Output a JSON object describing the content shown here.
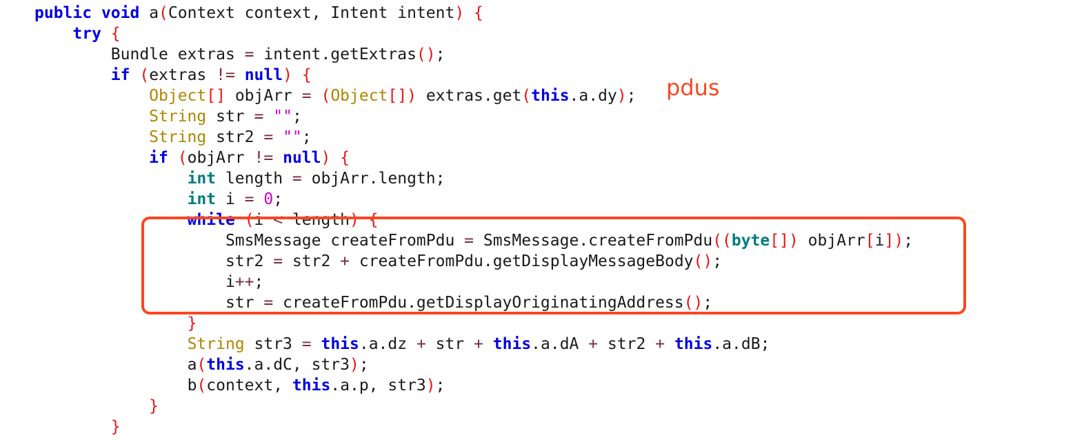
{
  "colors": {
    "keyword": "#0000e6",
    "type": "#ae8600",
    "primitive": "#007c80",
    "punctuation": "#ee1111",
    "string": "#cc00cc",
    "number": "#cc00cc",
    "operator": "#7a2a3a",
    "identifier": "#1a1a1a",
    "annotation": "#fa4620"
  },
  "annotation": {
    "text": "pdus"
  },
  "code": [
    {
      "indent": 0,
      "tokens": [
        [
          "kw",
          "public"
        ],
        [
          "id",
          " "
        ],
        [
          "kw",
          "void"
        ],
        [
          "id",
          " a"
        ],
        [
          "pn",
          "("
        ],
        [
          "id",
          "Context context, Intent intent"
        ],
        [
          "pn",
          ")"
        ],
        [
          "id",
          " "
        ],
        [
          "pn",
          "{"
        ]
      ]
    },
    {
      "indent": 1,
      "tokens": [
        [
          "kw",
          "try"
        ],
        [
          "id",
          " "
        ],
        [
          "pn",
          "{"
        ]
      ]
    },
    {
      "indent": 2,
      "tokens": [
        [
          "id",
          "Bundle extras "
        ],
        [
          "op",
          "="
        ],
        [
          "id",
          " intent.getExtras"
        ],
        [
          "pn",
          "()"
        ],
        [
          "id",
          ";"
        ]
      ]
    },
    {
      "indent": 2,
      "tokens": [
        [
          "kw",
          "if"
        ],
        [
          "id",
          " "
        ],
        [
          "pn",
          "("
        ],
        [
          "id",
          "extras "
        ],
        [
          "op",
          "!="
        ],
        [
          "id",
          " "
        ],
        [
          "kw",
          "null"
        ],
        [
          "pn",
          ")"
        ],
        [
          "id",
          " "
        ],
        [
          "pn",
          "{"
        ]
      ]
    },
    {
      "indent": 3,
      "tokens": [
        [
          "tp",
          "Object"
        ],
        [
          "pn",
          "[]"
        ],
        [
          "id",
          " objArr "
        ],
        [
          "op",
          "="
        ],
        [
          "id",
          " "
        ],
        [
          "pn",
          "("
        ],
        [
          "tp",
          "Object"
        ],
        [
          "pn",
          "[])"
        ],
        [
          "id",
          " extras.get"
        ],
        [
          "pn",
          "("
        ],
        [
          "kw",
          "this"
        ],
        [
          "id",
          ".a.dy"
        ],
        [
          "pn",
          ")"
        ],
        [
          "id",
          ";"
        ]
      ]
    },
    {
      "indent": 3,
      "tokens": [
        [
          "tp",
          "String"
        ],
        [
          "id",
          " str "
        ],
        [
          "op",
          "="
        ],
        [
          "id",
          " "
        ],
        [
          "st",
          "\"\""
        ],
        [
          "id",
          ";"
        ]
      ]
    },
    {
      "indent": 3,
      "tokens": [
        [
          "tp",
          "String"
        ],
        [
          "id",
          " str2 "
        ],
        [
          "op",
          "="
        ],
        [
          "id",
          " "
        ],
        [
          "st",
          "\"\""
        ],
        [
          "id",
          ";"
        ]
      ]
    },
    {
      "indent": 3,
      "tokens": [
        [
          "kw",
          "if"
        ],
        [
          "id",
          " "
        ],
        [
          "pn",
          "("
        ],
        [
          "id",
          "objArr "
        ],
        [
          "op",
          "!="
        ],
        [
          "id",
          " "
        ],
        [
          "kw",
          "null"
        ],
        [
          "pn",
          ")"
        ],
        [
          "id",
          " "
        ],
        [
          "pn",
          "{"
        ]
      ]
    },
    {
      "indent": 4,
      "tokens": [
        [
          "pr",
          "int"
        ],
        [
          "id",
          " length "
        ],
        [
          "op",
          "="
        ],
        [
          "id",
          " objArr.length;"
        ]
      ]
    },
    {
      "indent": 4,
      "tokens": [
        [
          "pr",
          "int"
        ],
        [
          "id",
          " i "
        ],
        [
          "op",
          "="
        ],
        [
          "id",
          " "
        ],
        [
          "nm",
          "0"
        ],
        [
          "id",
          ";"
        ]
      ]
    },
    {
      "indent": 4,
      "tokens": [
        [
          "kw",
          "while"
        ],
        [
          "id",
          " "
        ],
        [
          "pn",
          "("
        ],
        [
          "id",
          "i "
        ],
        [
          "op",
          "<"
        ],
        [
          "id",
          " length"
        ],
        [
          "pn",
          ")"
        ],
        [
          "id",
          " "
        ],
        [
          "pn",
          "{"
        ]
      ]
    },
    {
      "indent": 5,
      "tokens": [
        [
          "id",
          "SmsMessage createFromPdu "
        ],
        [
          "op",
          "="
        ],
        [
          "id",
          " SmsMessage.createFromPdu"
        ],
        [
          "pn",
          "(("
        ],
        [
          "pr",
          "byte"
        ],
        [
          "pn",
          "[])"
        ],
        [
          "id",
          " objArr"
        ],
        [
          "pn",
          "["
        ],
        [
          "id",
          "i"
        ],
        [
          "pn",
          "])"
        ],
        [
          "id",
          ";"
        ]
      ]
    },
    {
      "indent": 5,
      "tokens": [
        [
          "id",
          "str2 "
        ],
        [
          "op",
          "="
        ],
        [
          "id",
          " str2 "
        ],
        [
          "op",
          "+"
        ],
        [
          "id",
          " createFromPdu.getDisplayMessageBody"
        ],
        [
          "pn",
          "()"
        ],
        [
          "id",
          ";"
        ]
      ]
    },
    {
      "indent": 5,
      "tokens": [
        [
          "id",
          "i"
        ],
        [
          "op",
          "++"
        ],
        [
          "id",
          ";"
        ]
      ]
    },
    {
      "indent": 5,
      "tokens": [
        [
          "id",
          "str "
        ],
        [
          "op",
          "="
        ],
        [
          "id",
          " createFromPdu.getDisplayOriginatingAddress"
        ],
        [
          "pn",
          "()"
        ],
        [
          "id",
          ";"
        ]
      ]
    },
    {
      "indent": 4,
      "tokens": [
        [
          "pn",
          "}"
        ]
      ]
    },
    {
      "indent": 4,
      "tokens": [
        [
          "tp",
          "String"
        ],
        [
          "id",
          " str3 "
        ],
        [
          "op",
          "="
        ],
        [
          "id",
          " "
        ],
        [
          "kw",
          "this"
        ],
        [
          "id",
          ".a.dz "
        ],
        [
          "op",
          "+"
        ],
        [
          "id",
          " str "
        ],
        [
          "op",
          "+"
        ],
        [
          "id",
          " "
        ],
        [
          "kw",
          "this"
        ],
        [
          "id",
          ".a.dA "
        ],
        [
          "op",
          "+"
        ],
        [
          "id",
          " str2 "
        ],
        [
          "op",
          "+"
        ],
        [
          "id",
          " "
        ],
        [
          "kw",
          "this"
        ],
        [
          "id",
          ".a.dB;"
        ]
      ]
    },
    {
      "indent": 4,
      "tokens": [
        [
          "id",
          "a"
        ],
        [
          "pn",
          "("
        ],
        [
          "kw",
          "this"
        ],
        [
          "id",
          ".a.dC, str3"
        ],
        [
          "pn",
          ")"
        ],
        [
          "id",
          ";"
        ]
      ]
    },
    {
      "indent": 4,
      "tokens": [
        [
          "id",
          "b"
        ],
        [
          "pn",
          "("
        ],
        [
          "id",
          "context, "
        ],
        [
          "kw",
          "this"
        ],
        [
          "id",
          ".a.p, str3"
        ],
        [
          "pn",
          ")"
        ],
        [
          "id",
          ";"
        ]
      ]
    },
    {
      "indent": 3,
      "tokens": [
        [
          "pn",
          "}"
        ]
      ]
    },
    {
      "indent": 2,
      "tokens": [
        [
          "pn",
          "}"
        ]
      ]
    }
  ]
}
